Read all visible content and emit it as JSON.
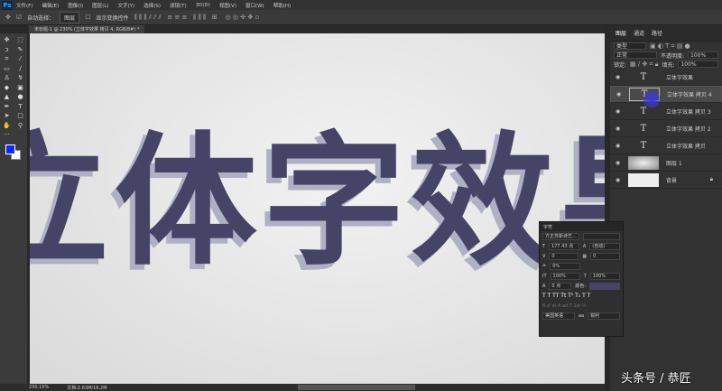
{
  "app": {
    "logo": "Ps"
  },
  "menu": [
    "文件(F)",
    "编辑(E)",
    "图像(I)",
    "图层(L)",
    "文字(Y)",
    "选择(S)",
    "滤镜(T)",
    "3D(D)",
    "视图(V)",
    "窗口(W)",
    "帮助(H)"
  ],
  "options": {
    "auto_select": "自动选择：",
    "auto_select_value": "图层",
    "show_transform": "显示变换控件"
  },
  "document_tab": "未标题-1 @ 230% (立体字效果 拷贝 4, RGB/8#) *",
  "canvas_text": "立体字效果",
  "status": {
    "zoom": "230.15%",
    "doc": "文档:2.63M/16.2M"
  },
  "layers_panel": {
    "tabs": [
      "图层",
      "通道",
      "路径"
    ],
    "filter": "类型",
    "blend": "正常",
    "opacity_label": "不透明度:",
    "opacity": "100%",
    "lock_label": "锁定:",
    "fill_label": "填充:",
    "fill": "100%",
    "layers": [
      {
        "name": "立体字效果",
        "type": "T"
      },
      {
        "name": "立体字效果 拷贝 4",
        "type": "T"
      },
      {
        "name": "立体字效果 拷贝 3",
        "type": "T"
      },
      {
        "name": "立体字效果 拷贝 2",
        "type": "T"
      },
      {
        "name": "立体字效果 拷贝",
        "type": "T"
      },
      {
        "name": "图层 1",
        "type": "img"
      },
      {
        "name": "背景",
        "type": "bg"
      }
    ]
  },
  "character_panel": {
    "title": "字符",
    "font": "方正苏新诗艺...",
    "size": "177.43 点",
    "leading": "(自动)",
    "kerning": "0",
    "tracking": "0",
    "scale_pct": "0%",
    "vscale": "100%",
    "hscale": "100%",
    "baseline": "0 点",
    "color_label": "颜色:",
    "styles": "T T TT Tt T¹ T₁ T T",
    "language": "美国英语",
    "aa_label": "aa",
    "aa": "锐利",
    "text_color": "#454466"
  },
  "watermark": "头条号 / 恭匠"
}
